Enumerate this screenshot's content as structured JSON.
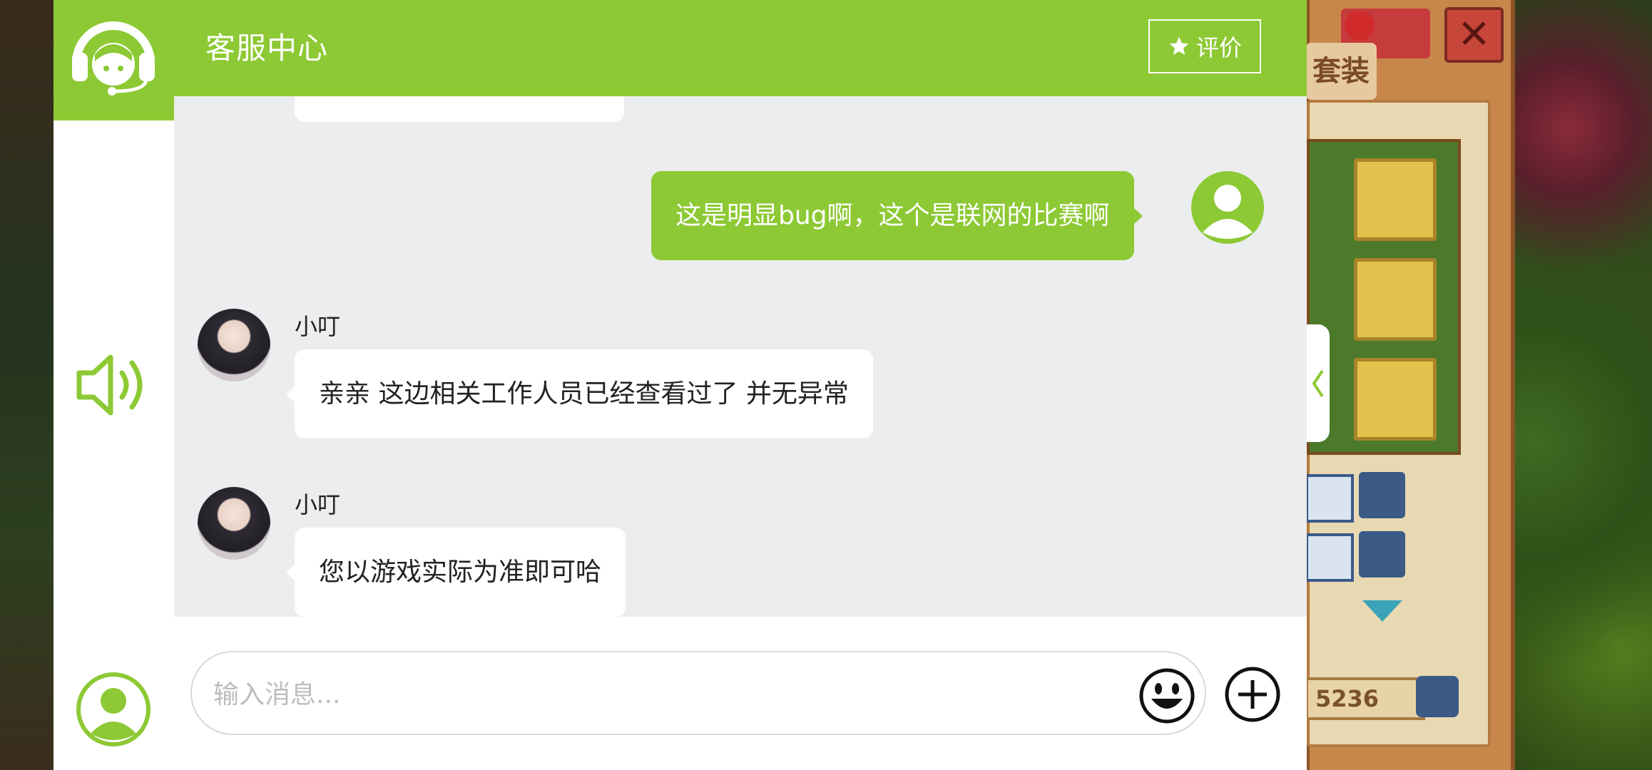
{
  "header": {
    "title": "客服中心",
    "rate_label": "评价"
  },
  "messages": [
    {
      "from": "user",
      "text": "这是明显bug啊，这个是联网的比赛啊"
    },
    {
      "from": "agent",
      "name": "小叮",
      "text": "亲亲 这边相关工作人员已经查看过了 并无异常"
    },
    {
      "from": "agent",
      "name": "小叮",
      "text": "您以游戏实际为准即可哈"
    }
  ],
  "composer": {
    "placeholder": "输入消息..."
  },
  "game": {
    "tag_label": "套装",
    "coin_value": "5236"
  },
  "colors": {
    "accent": "#8dc934",
    "chat_bg": "#ecedee"
  },
  "icons": [
    "headset-icon",
    "speaker-icon",
    "user-icon",
    "star-icon",
    "emoji-icon",
    "plus-icon",
    "chevron-left-icon"
  ]
}
